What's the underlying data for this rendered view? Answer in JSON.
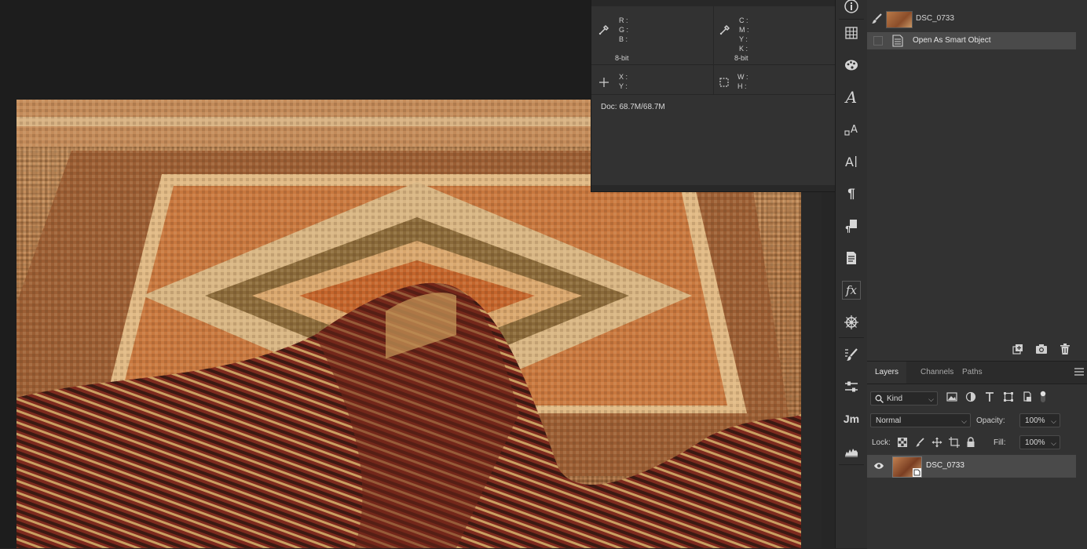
{
  "info_panel": {
    "rgb_labels": [
      "R :",
      "G :",
      "B :"
    ],
    "rgb_bitdepth": "8-bit",
    "cmyk_labels": [
      "C :",
      "M :",
      "Y :",
      "K :"
    ],
    "cmyk_bitdepth": "8-bit",
    "xy_labels": [
      "X :",
      "Y :"
    ],
    "wh_labels": [
      "W :",
      "H :"
    ],
    "doc_size": "Doc: 68.7M/68.7M",
    "icons": [
      "eyedropper-icon",
      "eyedropper-icon",
      "crosshair-icon",
      "selection-size-icon"
    ]
  },
  "dock": {
    "icons": [
      "info-icon",
      "grid-icon",
      "palette-icon",
      "character-style-icon",
      "glyphs-icon",
      "character-icon",
      "paragraph-icon",
      "paragraph-styles-icon",
      "notes-icon",
      "styles-fx-icon",
      "navigator-wheel-icon",
      "brush-presets-icon",
      "adjustments-icon",
      "jm-plugin-icon",
      "histogram-icon"
    ],
    "jm_label": "Jm",
    "fx_label": "fx"
  },
  "history": {
    "snapshot_name": "DSC_0733",
    "step_label": "Open As Smart Object",
    "footer_icons": [
      "new-document-from-state-icon",
      "camera-snapshot-icon",
      "trash-icon"
    ]
  },
  "layers": {
    "tabs": [
      "Layers",
      "Channels",
      "Paths"
    ],
    "active_tab": "Layers",
    "filter_kind": "Kind",
    "blend_mode": "Normal",
    "opacity_label": "Opacity:",
    "opacity_value": "100%",
    "lock_label": "Lock:",
    "fill_label": "Fill:",
    "fill_value": "100%",
    "layer_name": "DSC_0733"
  },
  "colors": {
    "panel_bg": "#323232",
    "canvas_bg": "#1d1d1d",
    "selected_row": "#4a4a4a"
  }
}
